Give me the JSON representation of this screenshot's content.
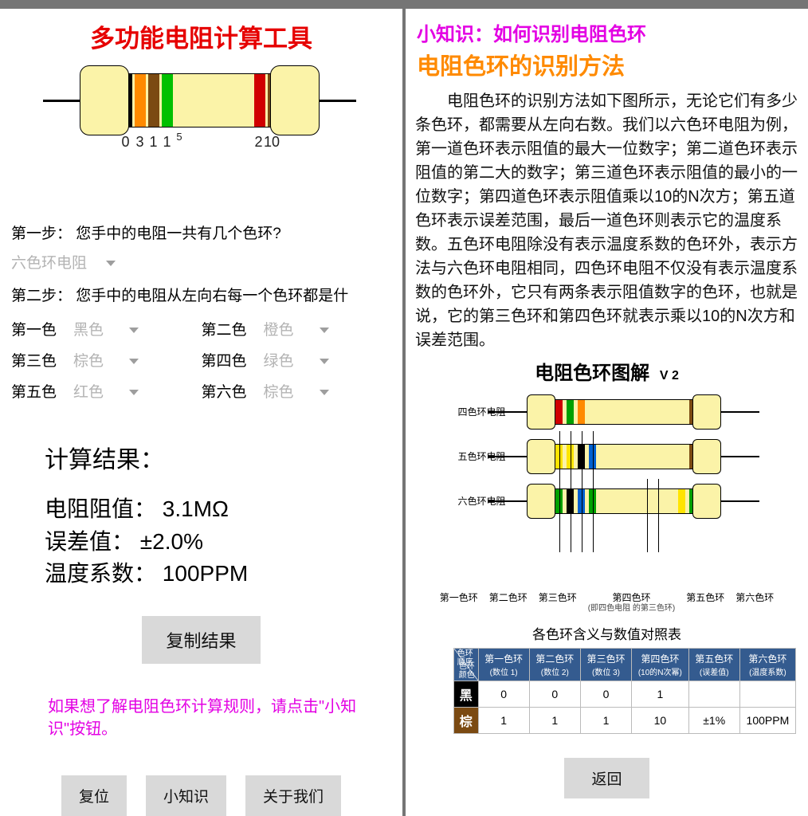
{
  "left": {
    "title": "多功能电阻计算工具",
    "band_digits": {
      "d1": "0",
      "d2": "3",
      "d3": "1",
      "d4": "1",
      "exp": "5",
      "d5": "2",
      "d6": "10"
    },
    "step1_label": "第一步：",
    "step1_q": "您手中的电阻一共有几个色环?",
    "ring_count_value": "六色环电阻",
    "step2_label": "第二步：",
    "step2_q": "您手中的电阻从左向右每一个色环都是什",
    "colors": [
      {
        "label": "第一色",
        "value": "黑色"
      },
      {
        "label": "第二色",
        "value": "橙色"
      },
      {
        "label": "第三色",
        "value": "棕色"
      },
      {
        "label": "第四色",
        "value": "绿色"
      },
      {
        "label": "第五色",
        "value": "红色"
      },
      {
        "label": "第六色",
        "value": "棕色"
      }
    ],
    "result_title": "计算结果：",
    "result_lines": {
      "res_label": "电阻阻值：",
      "res_val": "3.1MΩ",
      "tol_label": "误差值：",
      "tol_val": "±2.0%",
      "temp_label": "温度系数：",
      "temp_val": "100PPM"
    },
    "copy_btn": "复制结果",
    "hint": "如果想了解电阻色环计算规则，请点击\"小知识\"按钮。",
    "btn_reset": "复位",
    "btn_tip": "小知识",
    "btn_about": "关于我们"
  },
  "right": {
    "tip_title": "小知识：如何识别电阻色环",
    "sub_title": "电阻色环的识别方法",
    "body": "电阻色环的识别方法如下图所示，无论它们有多少条色环，都需要从左向右数。我们以六色环电阻为例，第一道色环表示阻值的最大一位数字；第二道色环表示阻值的第二大的数字；第三道色环表示阻值的最小的一位数字；第四道色环表示阻值乘以10的N次方；第五道色环表示误差范围，最后一道色环则表示它的温度系数。五色环电阻除没有表示温度系数的色环外，表示方法与六色环电阻相同，四色环电阻不仅没有表示温度系数的色环外，它只有两条表示阻值数字的色环，也就是说，它的第三色环和第四色环就表示乘以10的N次方和误差范围。",
    "diagram_title": "电阻色环图解",
    "diagram_v": "V 2",
    "rows": [
      {
        "label": "四色环电阻",
        "bands": [
          "#d00000",
          "#00a000",
          "#ff8a00",
          "",
          "",
          "#7b4a12"
        ]
      },
      {
        "label": "五色环电阻",
        "bands": [
          "#ffe400",
          "#ffe400",
          "#000",
          "#0060d0",
          "",
          "#7b4a12"
        ]
      },
      {
        "label": "六色环电阻",
        "bands": [
          "#00a000",
          "#000",
          "#0060d0",
          "#00a000",
          "#ffe400",
          "#00a000"
        ]
      }
    ],
    "leaders": [
      "第一色环",
      "第二色环",
      "第三色环",
      {
        "t": "第四色环",
        "s": "(即四色电阻 的第三色环)"
      },
      "第五色环",
      "第六色环"
    ],
    "table_caption": "各色环含义与数值对照表",
    "headers": [
      {
        "t": "第一色环",
        "s": "(数位 1)"
      },
      {
        "t": "第二色环",
        "s": "(数位 2)"
      },
      {
        "t": "第三色环",
        "s": "(数位 3)"
      },
      {
        "t": "第四色环",
        "s": "(10的N次幂)"
      },
      {
        "t": "第五色环",
        "s": "(误差值)"
      },
      {
        "t": "第六色环",
        "s": "(温度系数)"
      }
    ],
    "corner": {
      "a": "色环顺序",
      "b": "色环颜色"
    },
    "data_rows": [
      {
        "name": "黑",
        "cls": "black",
        "v": [
          "0",
          "0",
          "0",
          "1",
          "",
          ""
        ]
      },
      {
        "name": "棕",
        "cls": "brown",
        "v": [
          "1",
          "1",
          "1",
          "10",
          "±1%",
          "100PPM"
        ]
      }
    ],
    "back_btn": "返回"
  },
  "band_colors": {
    "black": "#000",
    "orange": "#ff8a00",
    "brown": "#7b4a12",
    "green": "#00c000",
    "red": "#d00000"
  }
}
